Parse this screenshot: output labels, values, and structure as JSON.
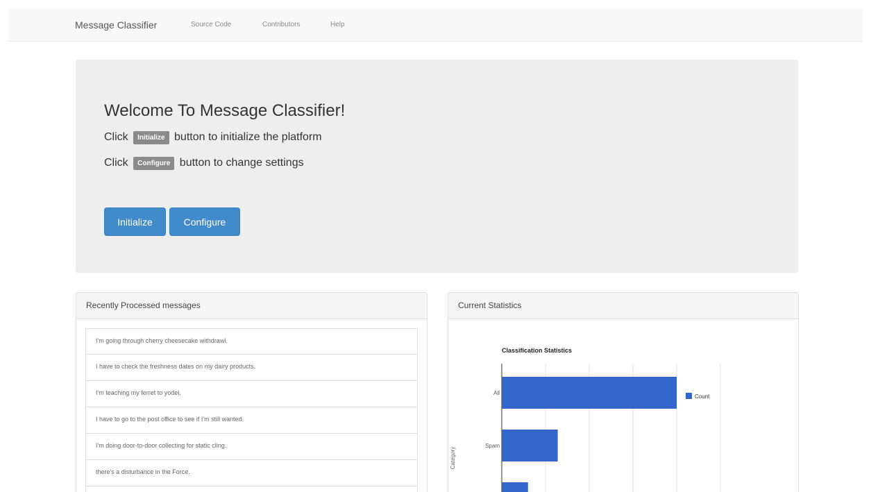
{
  "navbar": {
    "brand": "Message Classifier",
    "links": [
      "Source Code",
      "Contributors",
      "Help"
    ]
  },
  "jumbotron": {
    "title": "Welcome To Message Classifier!",
    "line1": {
      "prefix": "Click",
      "key": "Initialize",
      "suffix": "button to initialize the platform"
    },
    "line2": {
      "prefix": "Click",
      "key": "Configure",
      "suffix": "button to change settings"
    },
    "buttons": {
      "initialize": "Initialize",
      "configure": "Configure"
    }
  },
  "recent_panel": {
    "heading": "Recently Processed messages",
    "messages": [
      "I'm going through cherry cheesecake withdrawl.",
      "I have to check the freshness dates on my dairy products.",
      "I'm teaching my ferret to yodel.",
      "I have to go to the post office to see if I'm still wanted.",
      "I'm doing door-to-door collecting for static cling.",
      "there's a disturbance in the Force."
    ]
  },
  "stats_panel": {
    "heading": "Current Statistics"
  },
  "colors": {
    "primary": "#428bca",
    "bar": "#3366cc"
  },
  "chart_data": {
    "type": "bar",
    "orientation": "horizontal",
    "title": "Classification Statistics",
    "ylabel": "Category",
    "categories": [
      "All",
      "Spam",
      ""
    ],
    "series": [
      {
        "name": "Count",
        "values": [
          100,
          32,
          15
        ]
      }
    ],
    "xlim": [
      0,
      125
    ],
    "grid": true,
    "legend": "right"
  }
}
